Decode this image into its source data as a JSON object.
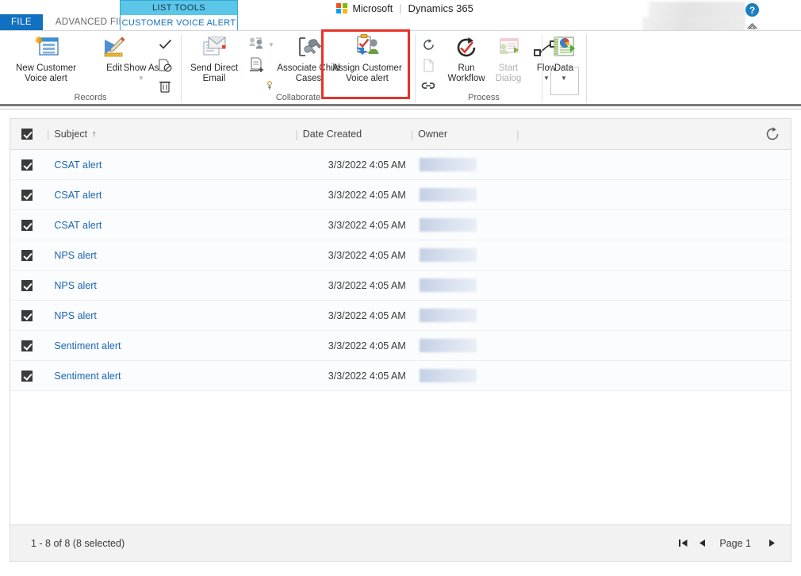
{
  "titlebar": {
    "file_tab": "FILE",
    "advanced_find_tab": "ADVANCED FIND",
    "contextual_group_title": "LIST TOOLS",
    "contextual_tab": "CUSTOMER VOICE ALERT",
    "brand_microsoft": "Microsoft",
    "brand_separator": "|",
    "brand_product": "Dynamics 365",
    "help_label": "?"
  },
  "ribbon": {
    "groups": [
      {
        "name": "Records",
        "label": "Records",
        "buttons": [
          {
            "label": "New Customer Voice alert",
            "icon": "new-record-icon",
            "disabled": false
          },
          {
            "label": "Edit",
            "icon": "edit-icon",
            "disabled": false
          },
          {
            "label": "Show As",
            "icon": "show-as-icon",
            "disabled": false,
            "has_caret": true
          }
        ],
        "mini_buttons": [
          {
            "icon": "activate-check-icon"
          },
          {
            "icon": "deactivate-icon"
          },
          {
            "icon": "delete-trash-icon"
          }
        ]
      },
      {
        "name": "Collaborate",
        "label": "Collaborate",
        "buttons": [
          {
            "label": "Send Direct Email",
            "icon": "send-direct-email-icon",
            "disabled": false
          },
          {
            "label": "Associate Child Cases",
            "icon": "associate-child-cases-icon",
            "disabled": false
          },
          {
            "label": "Assign Customer Voice alert",
            "icon": "assign-record-icon",
            "disabled": false,
            "highlighted": true
          }
        ],
        "mini_buttons": [
          {
            "icon": "connect-icon",
            "has_caret": true
          },
          {
            "icon": "add-to-queue-icon"
          },
          {
            "icon": "merge-icon"
          }
        ]
      },
      {
        "name": "Process",
        "label": "Process",
        "buttons": [
          {
            "label": "Run Workflow",
            "icon": "run-workflow-icon",
            "disabled": false
          },
          {
            "label": "Start Dialog",
            "icon": "start-dialog-icon",
            "disabled": true
          },
          {
            "label": "Flow",
            "icon": "flow-icon",
            "disabled": false,
            "has_caret": true
          }
        ],
        "mini_buttons": [
          {
            "icon": "sync-icon"
          },
          {
            "icon": "document-icon",
            "disabled": true
          },
          {
            "icon": "link-icon"
          }
        ]
      },
      {
        "name": "Data",
        "label": "",
        "buttons": [
          {
            "label": "Data",
            "icon": "data-chart-icon",
            "disabled": false,
            "has_caret": true
          }
        ],
        "mini_buttons": []
      }
    ],
    "highlight_color": "#e8322b"
  },
  "grid": {
    "select_all_checked": true,
    "columns": [
      {
        "key": "subject",
        "label": "Subject",
        "sorted": "asc",
        "sort_glyph": "↑"
      },
      {
        "key": "date_created",
        "label": "Date Created"
      },
      {
        "key": "owner",
        "label": "Owner"
      }
    ],
    "refresh_icon": "refresh-icon",
    "rows": [
      {
        "checked": true,
        "subject": "CSAT alert",
        "date_created": "3/3/2022 4:05 AM",
        "owner": ""
      },
      {
        "checked": true,
        "subject": "CSAT alert",
        "date_created": "3/3/2022 4:05 AM",
        "owner": ""
      },
      {
        "checked": true,
        "subject": "CSAT alert",
        "date_created": "3/3/2022 4:05 AM",
        "owner": ""
      },
      {
        "checked": true,
        "subject": "NPS alert",
        "date_created": "3/3/2022 4:05 AM",
        "owner": ""
      },
      {
        "checked": true,
        "subject": "NPS alert",
        "date_created": "3/3/2022 4:05 AM",
        "owner": ""
      },
      {
        "checked": true,
        "subject": "NPS alert",
        "date_created": "3/3/2022 4:05 AM",
        "owner": ""
      },
      {
        "checked": true,
        "subject": "Sentiment alert",
        "date_created": "3/3/2022 4:05 AM",
        "owner": ""
      },
      {
        "checked": true,
        "subject": "Sentiment alert",
        "date_created": "3/3/2022 4:05 AM",
        "owner": ""
      }
    ],
    "footer": {
      "record_count": "1 - 8 of 8 (8 selected)",
      "page_label": "Page 1",
      "first_page_glyph": "⏮",
      "prev_page_glyph": "◀",
      "next_page_glyph": "▶"
    }
  }
}
